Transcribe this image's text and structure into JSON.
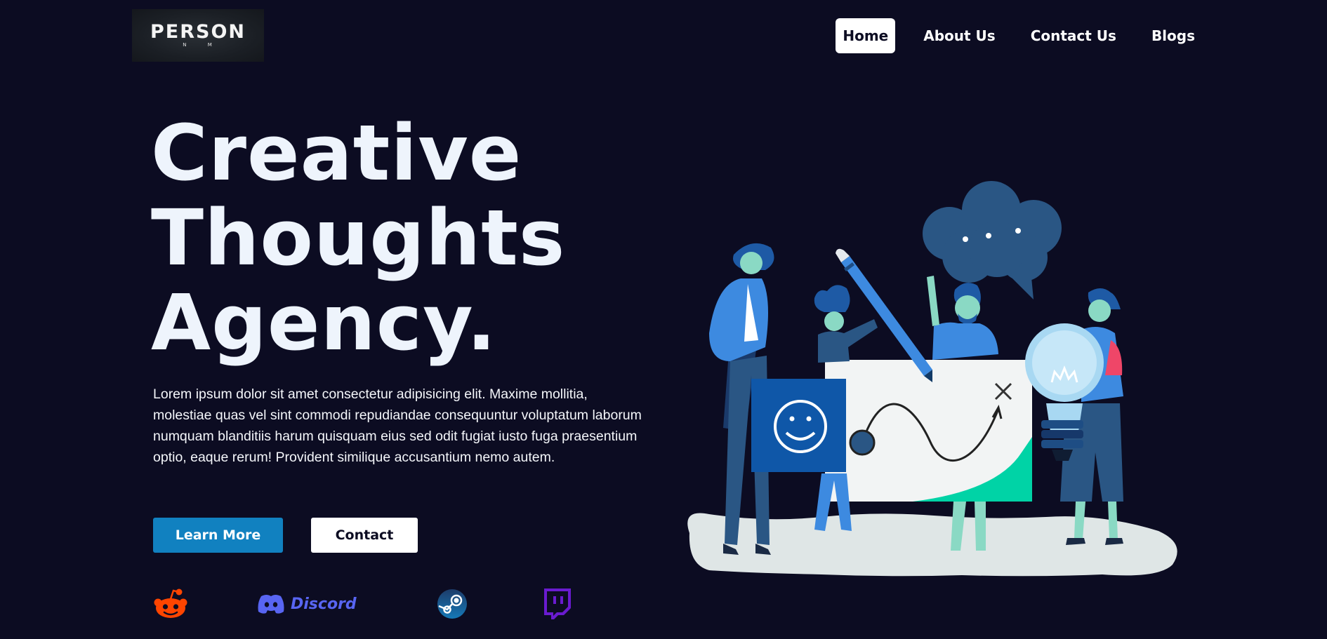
{
  "logo": {
    "main": "PERSON",
    "sub": "N M"
  },
  "nav": {
    "items": [
      {
        "label": "Home",
        "active": true
      },
      {
        "label": "About Us",
        "active": false
      },
      {
        "label": "Contact Us",
        "active": false
      },
      {
        "label": "Blogs",
        "active": false
      }
    ]
  },
  "hero": {
    "title_lines": [
      "Creative",
      "Thoughts",
      "Agency."
    ],
    "description": "Lorem ipsum dolor sit amet consectetur adipisicing elit. Maxime mollitia, molestiae quas vel sint commodi repudiandae consequuntur voluptatum laborum numquam blanditiis harum quisquam eius sed odit fugiat iusto fuga praesentium optio, eaque rerum! Provident similique accusantium nemo autem.",
    "primary_button": "Learn More",
    "secondary_button": "Contact"
  },
  "socials": {
    "reddit_icon": "reddit-icon",
    "discord_icon": "discord-icon",
    "discord_word": "Discord",
    "steam_icon": "steam-icon",
    "twitch_icon": "twitch-icon"
  },
  "colors": {
    "background": "#0c0c22",
    "primary_button": "#1181c0",
    "reddit": "#ff4500",
    "discord": "#5865f2",
    "twitch": "#6a1bd0",
    "illustration_accent": "#00d3a6"
  }
}
